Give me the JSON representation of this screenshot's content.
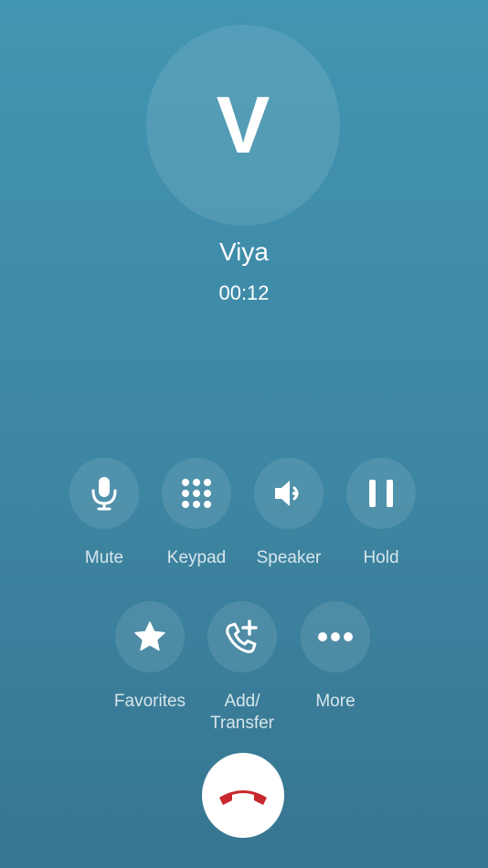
{
  "contact": {
    "initial": "V",
    "name": "Viya",
    "timer": "00:12"
  },
  "controls": {
    "mute": {
      "label": "Mute",
      "icon": "microphone-icon"
    },
    "keypad": {
      "label": "Keypad",
      "icon": "keypad-icon"
    },
    "speaker": {
      "label": "Speaker",
      "icon": "speaker-icon"
    },
    "hold": {
      "label": "Hold",
      "icon": "pause-icon"
    },
    "favorites": {
      "label": "Favorites",
      "icon": "star-icon"
    },
    "add_transfer": {
      "label_line1": "Add/",
      "label_line2": "Transfer",
      "icon": "add-call-icon"
    },
    "more": {
      "label": "More",
      "icon": "ellipsis-icon"
    }
  },
  "end_call": {
    "icon": "hang-up-icon"
  },
  "colors": {
    "background_top": "#4295b2",
    "background_bottom": "#377590",
    "hangup_red": "#c8282d",
    "white": "#ffffff"
  }
}
